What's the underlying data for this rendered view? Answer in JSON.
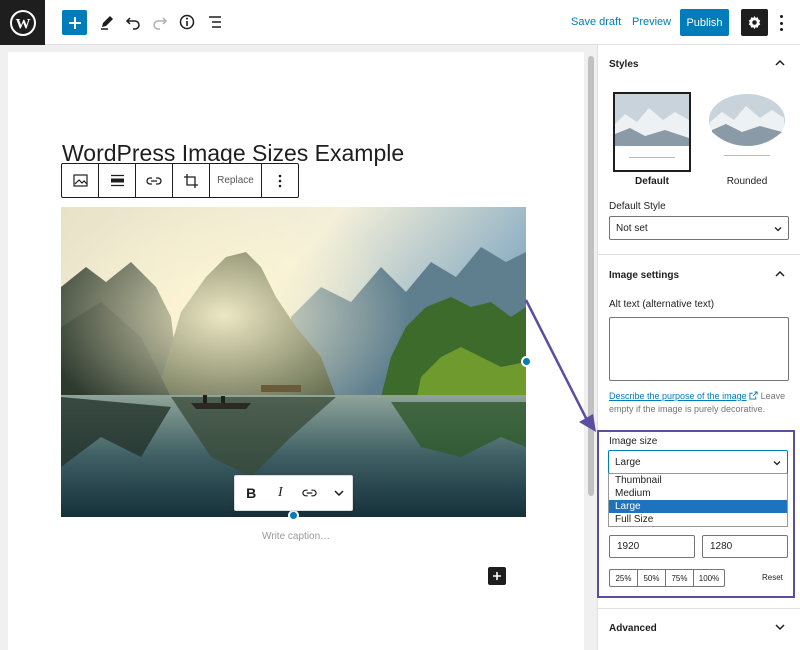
{
  "topbar": {
    "save_draft": "Save draft",
    "preview": "Preview",
    "publish": "Publish"
  },
  "editor": {
    "title": "WordPress Image Sizes Example",
    "block_toolbar": {
      "replace_label": "Replace"
    },
    "format_toolbar": {
      "bold": "B",
      "italic": "I"
    },
    "caption_placeholder": "Write caption…"
  },
  "sidebar": {
    "styles": {
      "heading": "Styles",
      "options": [
        {
          "label": "Default",
          "selected": true
        },
        {
          "label": "Rounded",
          "selected": false
        }
      ],
      "default_style_label": "Default Style",
      "default_style_value": "Not set"
    },
    "image_settings": {
      "heading": "Image settings",
      "alt_text_label": "Alt text (alternative text)",
      "help_link": "Describe the purpose of the image",
      "help_text": "Leave empty if the image is purely decorative.",
      "image_size_label": "Image size",
      "image_size_value": "Large",
      "size_options": [
        "Thumbnail",
        "Medium",
        "Large",
        "Full Size"
      ],
      "selected_option": "Large",
      "width": "1920",
      "height": "1280",
      "percent_buttons": [
        "25%",
        "50%",
        "75%",
        "100%"
      ],
      "reset": "Reset"
    },
    "advanced": {
      "heading": "Advanced"
    }
  },
  "colors": {
    "accent": "#007cba",
    "highlight_box": "#5b4ea1",
    "dark": "#1e1e1e"
  }
}
